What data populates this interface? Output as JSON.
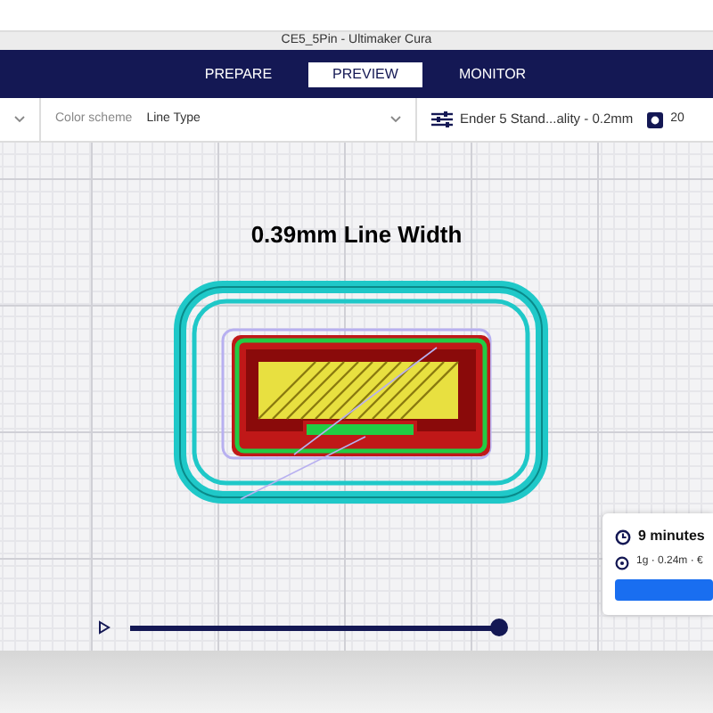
{
  "window": {
    "title": "CE5_5Pin - Ultimaker Cura"
  },
  "tabs": [
    {
      "label": "PREPARE",
      "selected": false
    },
    {
      "label": "PREVIEW",
      "selected": true
    },
    {
      "label": "MONITOR",
      "selected": false
    }
  ],
  "toolbar": {
    "color_scheme_label": "Color scheme",
    "color_scheme_value": "Line Type",
    "profile": "Ender 5 Stand...ality - 0.2mm",
    "extruder_count": "20"
  },
  "viewport": {
    "overlay_title": "0.39mm Line Width"
  },
  "print_panel": {
    "time": "9 minutes",
    "material": "1g · 0.24m · €"
  },
  "layer_slider": {
    "level": 1.0
  }
}
